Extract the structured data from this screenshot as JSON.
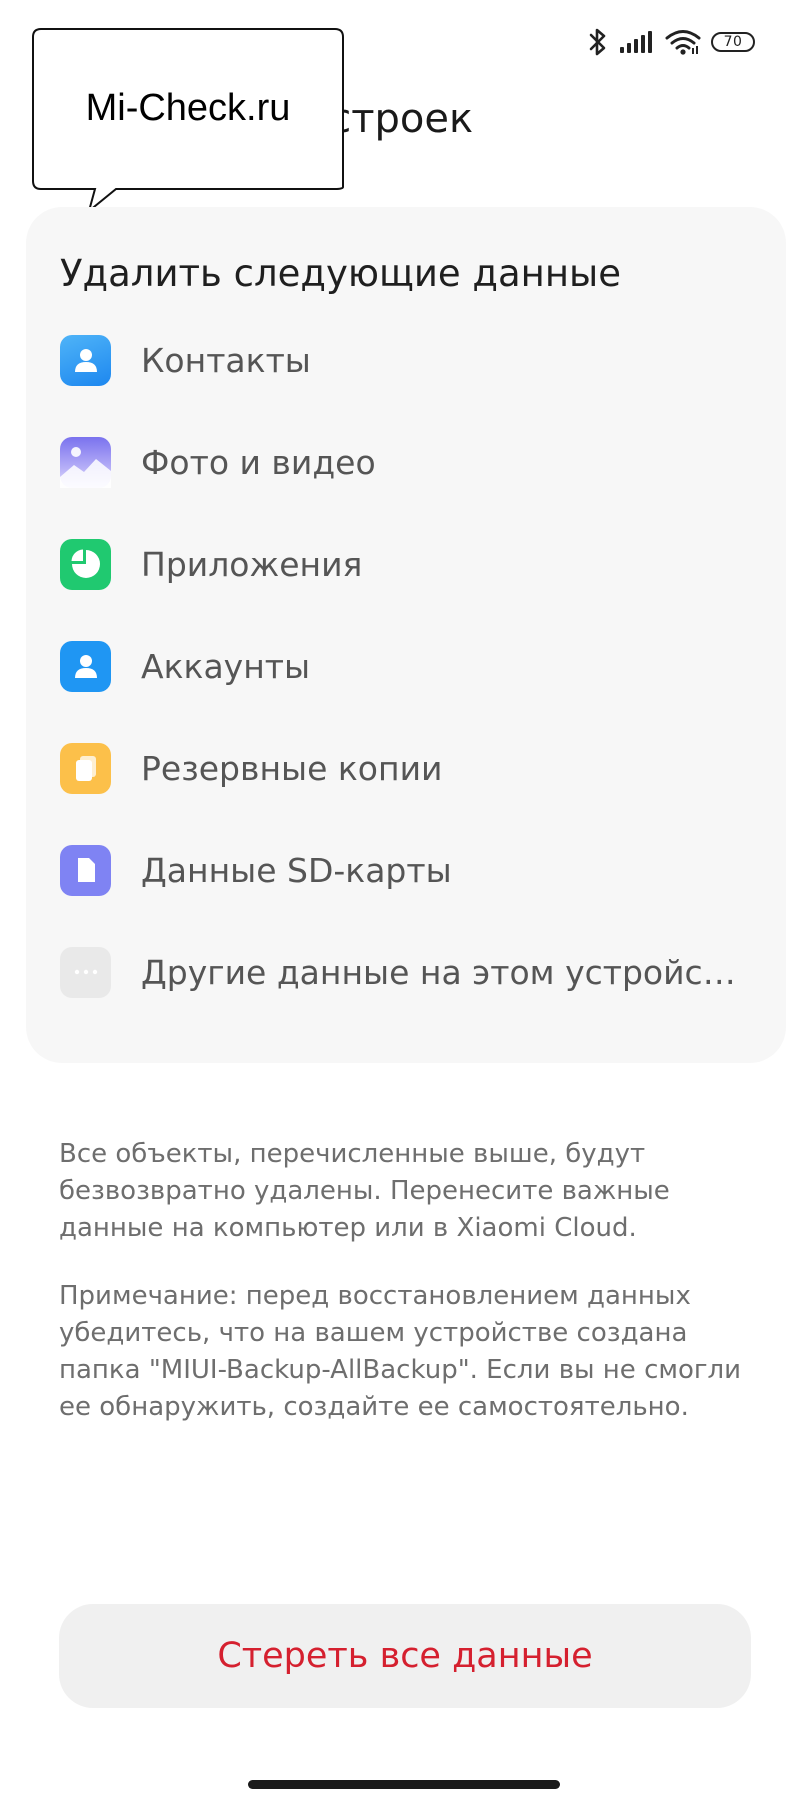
{
  "status_bar": {
    "battery_level": "70",
    "icons": [
      "bluetooth-icon",
      "signal-icon",
      "wifi-icon",
      "battery-icon"
    ]
  },
  "header": {
    "title_visible": "с настроек"
  },
  "watermark": {
    "text": "Mi-Check.ru"
  },
  "card": {
    "title": "Удалить следующие данные",
    "items": [
      {
        "label": "Контакты",
        "icon": "contacts-icon",
        "color": "#2f9bf5"
      },
      {
        "label": "Фото и видео",
        "icon": "gallery-icon",
        "color": "#8a7ff0"
      },
      {
        "label": "Приложения",
        "icon": "apps-pie-icon",
        "color": "#20c970"
      },
      {
        "label": "Аккаунты",
        "icon": "account-icon",
        "color": "#1f96f3"
      },
      {
        "label": "Резервные копии",
        "icon": "backup-icon",
        "color": "#fcc04a"
      },
      {
        "label": "Данные SD-карты",
        "icon": "sd-card-icon",
        "color": "#7f83f3"
      },
      {
        "label": "Другие данные на этом устройс…",
        "icon": "more-dots-icon",
        "color": "#e9e9e9"
      }
    ]
  },
  "notes": {
    "warning": "Все объекты, перечисленные выше, будут безвозвратно удалены. Перенесите важные данные на компьютер или в Xiaomi Cloud.",
    "remark": "Примечание: перед восстановлением данных убедитесь, что на вашем устройстве создана папка \"MIUI-Backup-AllBackup\". Если вы не смогли ее обнаружить, создайте ее самостоятельно."
  },
  "actions": {
    "erase_label": "Стереть все данные",
    "erase_color": "#d5202f"
  }
}
